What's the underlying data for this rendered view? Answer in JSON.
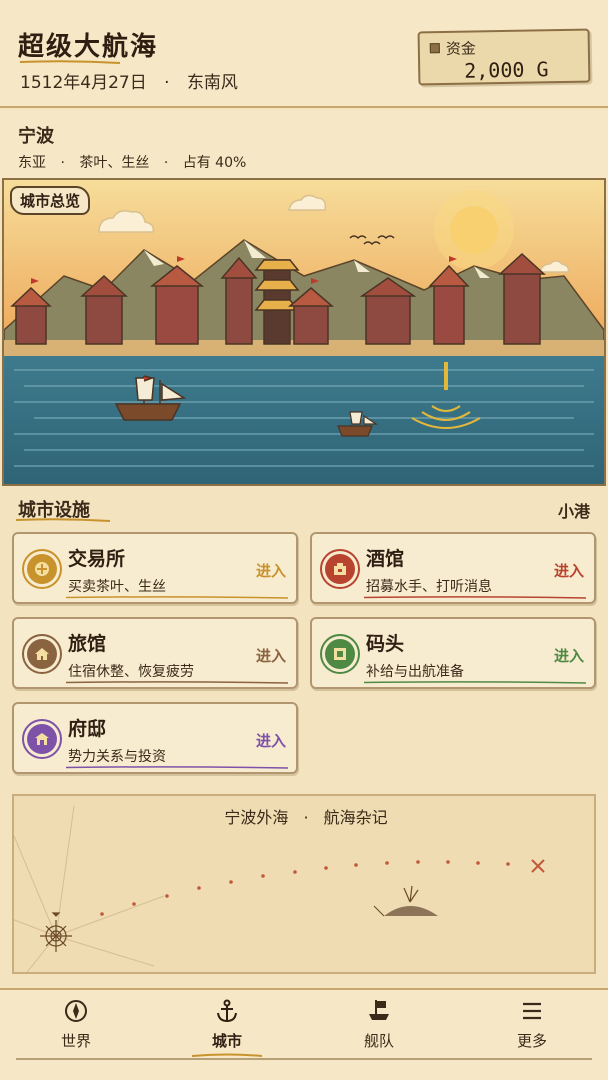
{
  "header": {
    "title": "超级大航海",
    "date": "1512年4月27日",
    "separator": "·",
    "wind": "东南风",
    "funds_label": "资金",
    "funds_value": "2,000 G"
  },
  "city": {
    "name": "宁波",
    "region": "东亚",
    "goods": "茶叶、生丝",
    "share": "占有 40%",
    "overview_tag": "城市总览"
  },
  "facilities": {
    "title": "城市设施",
    "port_size": "小港",
    "items": [
      {
        "name": "交易所",
        "desc": "买卖茶叶、生丝",
        "enter": "进入",
        "color": "#c8922c",
        "icon": "coin-icon"
      },
      {
        "name": "酒馆",
        "desc": "招募水手、打听消息",
        "enter": "进入",
        "color": "#b8442f",
        "icon": "tavern-icon"
      },
      {
        "name": "旅馆",
        "desc": "住宿休整、恢复疲劳",
        "enter": "进入",
        "color": "#8a6340",
        "icon": "inn-house-icon"
      },
      {
        "name": "码头",
        "desc": "补给与出航准备",
        "enter": "进入",
        "color": "#4f8a44",
        "icon": "dock-icon"
      },
      {
        "name": "府邸",
        "desc": "势力关系与投资",
        "enter": "进入",
        "color": "#7d52a8",
        "icon": "mansion-icon"
      }
    ]
  },
  "log": {
    "location": "宁波外海",
    "separator": "·",
    "title": "航海杂记"
  },
  "nav": {
    "items": [
      {
        "label": "世界",
        "icon": "compass-icon"
      },
      {
        "label": "城市",
        "icon": "anchor-icon"
      },
      {
        "label": "舰队",
        "icon": "ship-flag-icon"
      },
      {
        "label": "更多",
        "icon": "menu-icon"
      }
    ],
    "active": "城市"
  },
  "colors": {
    "parchment": "#f3e4bf",
    "ink": "#3b2a1a",
    "sea": "#3c7385",
    "sky": "#f1c070"
  }
}
